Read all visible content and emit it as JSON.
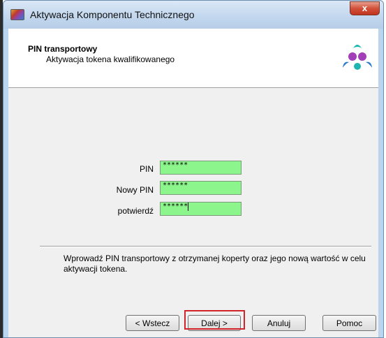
{
  "window": {
    "title": "Aktywacja Komponentu Technicznego",
    "close_label": "x"
  },
  "header": {
    "title": "PIN transportowy",
    "subtitle": "Aktywacja tokena kwalifikowanego"
  },
  "form": {
    "fields": [
      {
        "label": "PIN",
        "value": "******"
      },
      {
        "label": "Nowy PIN",
        "value": "******"
      },
      {
        "label": "potwierdź",
        "value": "******"
      }
    ],
    "field_color": "#8cf58c"
  },
  "info": {
    "text": "Wprowadź PIN transportowy z otrzymanej koperty oraz jego nową wartość w celu aktywacji tokena."
  },
  "buttons": {
    "back": "< Wstecz",
    "next": "Dalej >",
    "cancel": "Anuluj",
    "help": "Pomoc"
  },
  "colors": {
    "highlight": "#d1232a",
    "logo_teal": "#1eb5b0",
    "logo_purple": "#a23fb8",
    "logo_blue": "#2b7bd0"
  }
}
